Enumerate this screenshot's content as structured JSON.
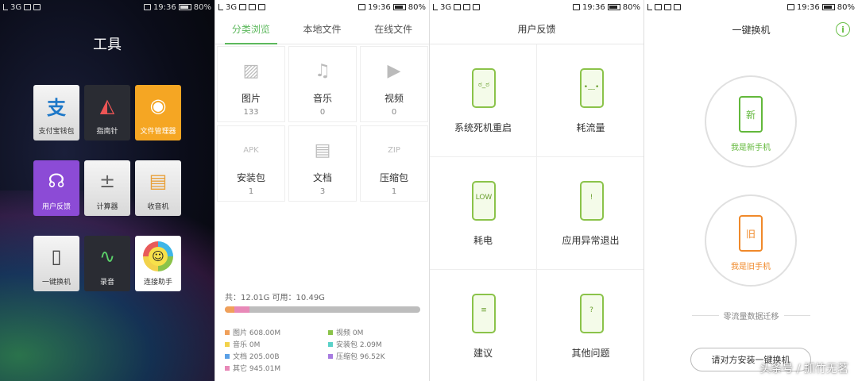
{
  "status": {
    "network": "3G",
    "time": "19:36",
    "battery": "80%"
  },
  "tools": {
    "title": "工具",
    "tiles": [
      {
        "label": "支付宝钱包",
        "glyph": "支",
        "icon": "alipay-icon"
      },
      {
        "label": "指南针",
        "glyph": "◭",
        "icon": "compass-icon"
      },
      {
        "label": "文件管理器",
        "glyph": "◉",
        "icon": "file-manager-icon"
      },
      {
        "label": "用户反馈",
        "glyph": "☊",
        "icon": "headset-icon"
      },
      {
        "label": "计算器",
        "glyph": "±",
        "icon": "calculator-icon"
      },
      {
        "label": "收音机",
        "glyph": "▤",
        "icon": "radio-icon"
      },
      {
        "label": "一键换机",
        "glyph": "▯",
        "icon": "phone-switch-icon"
      },
      {
        "label": "录音",
        "glyph": "∿",
        "icon": "recorder-icon"
      },
      {
        "label": "连接助手",
        "glyph": "☺",
        "icon": "connect-assistant-icon"
      }
    ]
  },
  "files": {
    "tabs": [
      "分类浏览",
      "本地文件",
      "在线文件"
    ],
    "categories": [
      {
        "name": "图片",
        "count": "133",
        "glyph": "▨"
      },
      {
        "name": "音乐",
        "count": "0",
        "glyph": "♫"
      },
      {
        "name": "视频",
        "count": "0",
        "glyph": "▶"
      },
      {
        "name": "安装包",
        "count": "1",
        "glyph": "APK"
      },
      {
        "name": "文档",
        "count": "3",
        "glyph": "▤"
      },
      {
        "name": "压缩包",
        "count": "1",
        "glyph": "ZIP"
      }
    ],
    "storage_text": "共：12.01G 可用：10.49G",
    "used_fraction": 0.127,
    "segments": [
      {
        "color": "#f0a05a",
        "fraction": 0.05
      },
      {
        "color": "#e889b8",
        "fraction": 0.077
      }
    ],
    "legend": [
      {
        "label": "图片 608.00M",
        "color": "#f0a05a"
      },
      {
        "label": "视频 0M",
        "color": "#8bc34a"
      },
      {
        "label": "音乐 0M",
        "color": "#f2d24b"
      },
      {
        "label": "安装包 2.09M",
        "color": "#5ad1c8"
      },
      {
        "label": "文档 205.00B",
        "color": "#5aa0e6"
      },
      {
        "label": "压缩包 96.52K",
        "color": "#a77be0"
      },
      {
        "label": "其它 945.01M",
        "color": "#e889b8"
      }
    ]
  },
  "feedback": {
    "title": "用户反馈",
    "items": [
      {
        "label": "系统死机重启",
        "face": "ಠ_ಠ"
      },
      {
        "label": "耗流量",
        "face": "•﹏•"
      },
      {
        "label": "耗电",
        "face": "LOW"
      },
      {
        "label": "应用异常退出",
        "face": "!"
      },
      {
        "label": "建议",
        "face": "≡"
      },
      {
        "label": "其他问题",
        "face": "?"
      }
    ]
  },
  "switch": {
    "title": "一键换机",
    "new_glyph": "新",
    "new_label": "我是新手机",
    "old_glyph": "旧",
    "old_label": "我是旧手机",
    "migrate_text": "零流量数据迁移",
    "invite_label": "请对方安装一键换机",
    "watermark": "头条号 / 抓竹无茗"
  }
}
